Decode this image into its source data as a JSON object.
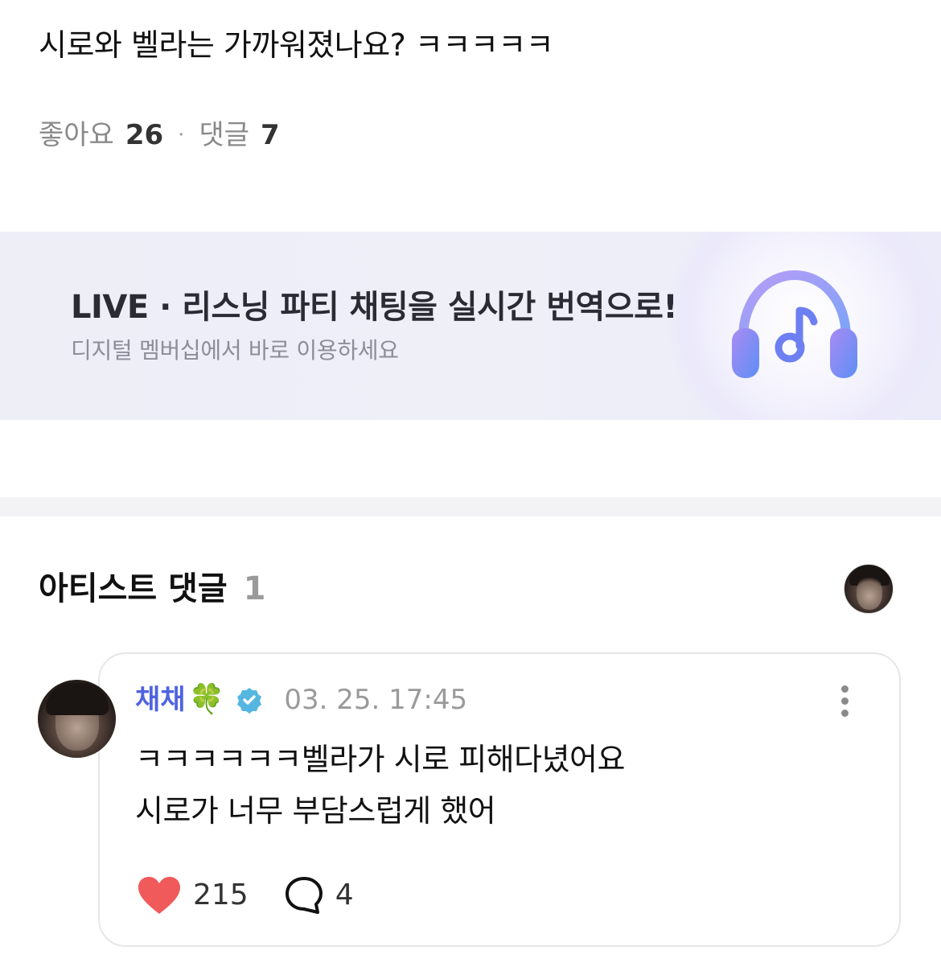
{
  "post": {
    "text": "시로와 벨라는 가까워졌나요? ㅋㅋㅋㅋㅋ",
    "likes_label": "좋아요",
    "likes_count": "26",
    "separator": "·",
    "comments_label": "댓글",
    "comments_count": "7"
  },
  "banner": {
    "title": "LIVE · 리스닝 파티 채팅을 실시간 번역으로!",
    "subtitle": "디지털 멤버십에서 바로 이용하세요",
    "icon": "headphones-music-icon",
    "accent_colors": [
      "#9b7ff0",
      "#6f8ef5"
    ]
  },
  "artist_comments": {
    "title": "아티스트 댓글",
    "count": "1"
  },
  "comment": {
    "author": "채채",
    "author_emoji": "🍀",
    "verified_icon": "verified-badge-icon",
    "timestamp": "03. 25. 17:45",
    "body_line1": "ㅋㅋㅋㅋㅋㅋ벨라가 시로 피해다녔어요",
    "body_line2": "시로가 너무 부담스럽게 했어",
    "like_count": "215",
    "reply_count": "4",
    "author_color": "#4f63e0",
    "heart_color": "#f05a5a"
  }
}
